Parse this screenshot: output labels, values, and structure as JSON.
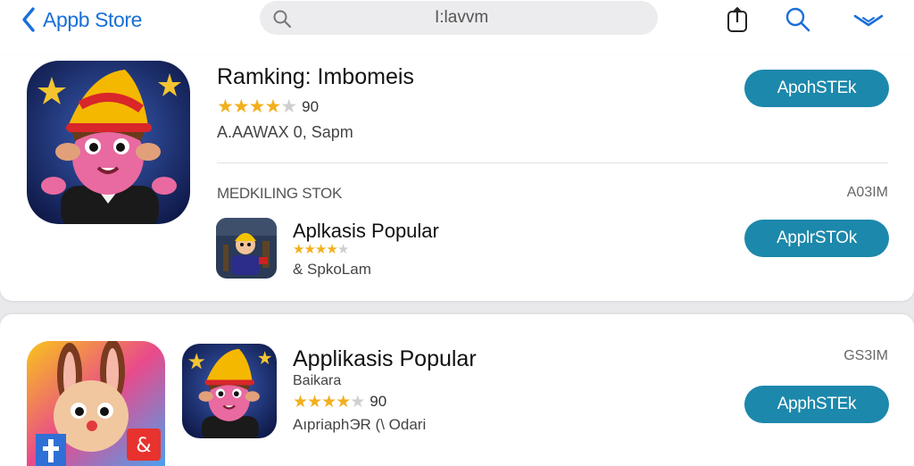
{
  "topbar": {
    "back_label": "Appb Store",
    "search_query": "I:lavvm",
    "icons": [
      "chevron-left-icon",
      "search-icon",
      "share-icon",
      "search-icon",
      "chevron-down-icon"
    ]
  },
  "featured": {
    "title": "Ramking: Imbomeis",
    "rating_count": "90",
    "stars_filled": 4,
    "stars_total": 5,
    "subtitle": "A.AAWAX  0, Sapm",
    "button_label": "ApohSTEk"
  },
  "section": {
    "heading": "MEDKILING STOK",
    "size": "A03IM"
  },
  "popular_row": {
    "title": "Aplkasis Popular",
    "stars_filled": 4,
    "stars_total": 5,
    "subtitle": "& SpkoLam",
    "button_label": "ApplrSTOk"
  },
  "second_card": {
    "title": "Applikasis Popular",
    "developer": "Baikara",
    "rating_count": "90",
    "stars_filled": 4,
    "stars_total": 5,
    "subtitle": "AıpriaphЭR  (\\ Odari",
    "size": "GS3IM",
    "button_label": "ApphSTEk"
  },
  "colors": {
    "accent_blue": "#1a6fd8",
    "button_teal": "#1c88ab",
    "star_gold": "#f2b01e"
  }
}
